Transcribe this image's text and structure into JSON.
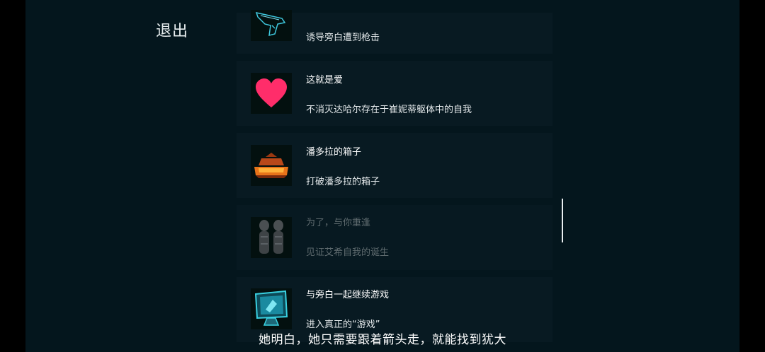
{
  "exit_label": "退出",
  "achievements": [
    {
      "title": "",
      "description": "诱导旁白遭到枪击",
      "icon": "pistol-icon",
      "locked": false
    },
    {
      "title": "这就是爱",
      "description": "不消灭达哈尔存在于崔妮蒂躯体中的自我",
      "icon": "heart-icon",
      "locked": false
    },
    {
      "title": "潘多拉的箱子",
      "description": "打破潘多拉的箱子",
      "icon": "pandora-box-icon",
      "locked": false
    },
    {
      "title": "为了，与你重逢",
      "description": "见证艾希自我的诞生",
      "icon": "twin-figures-icon",
      "locked": true
    },
    {
      "title": "与旁白一起继续游戏",
      "description": "进入真正的“游戏”",
      "icon": "monitor-icon",
      "locked": false
    }
  ],
  "subtitle": "她明白，她只需要跟着箭头走，就能找到犹大",
  "colors": {
    "background": "#04161d",
    "card": "#081a22",
    "heart": "#ff2d6a",
    "cyan": "#39d0e0",
    "box_orange": "#e8741a"
  }
}
